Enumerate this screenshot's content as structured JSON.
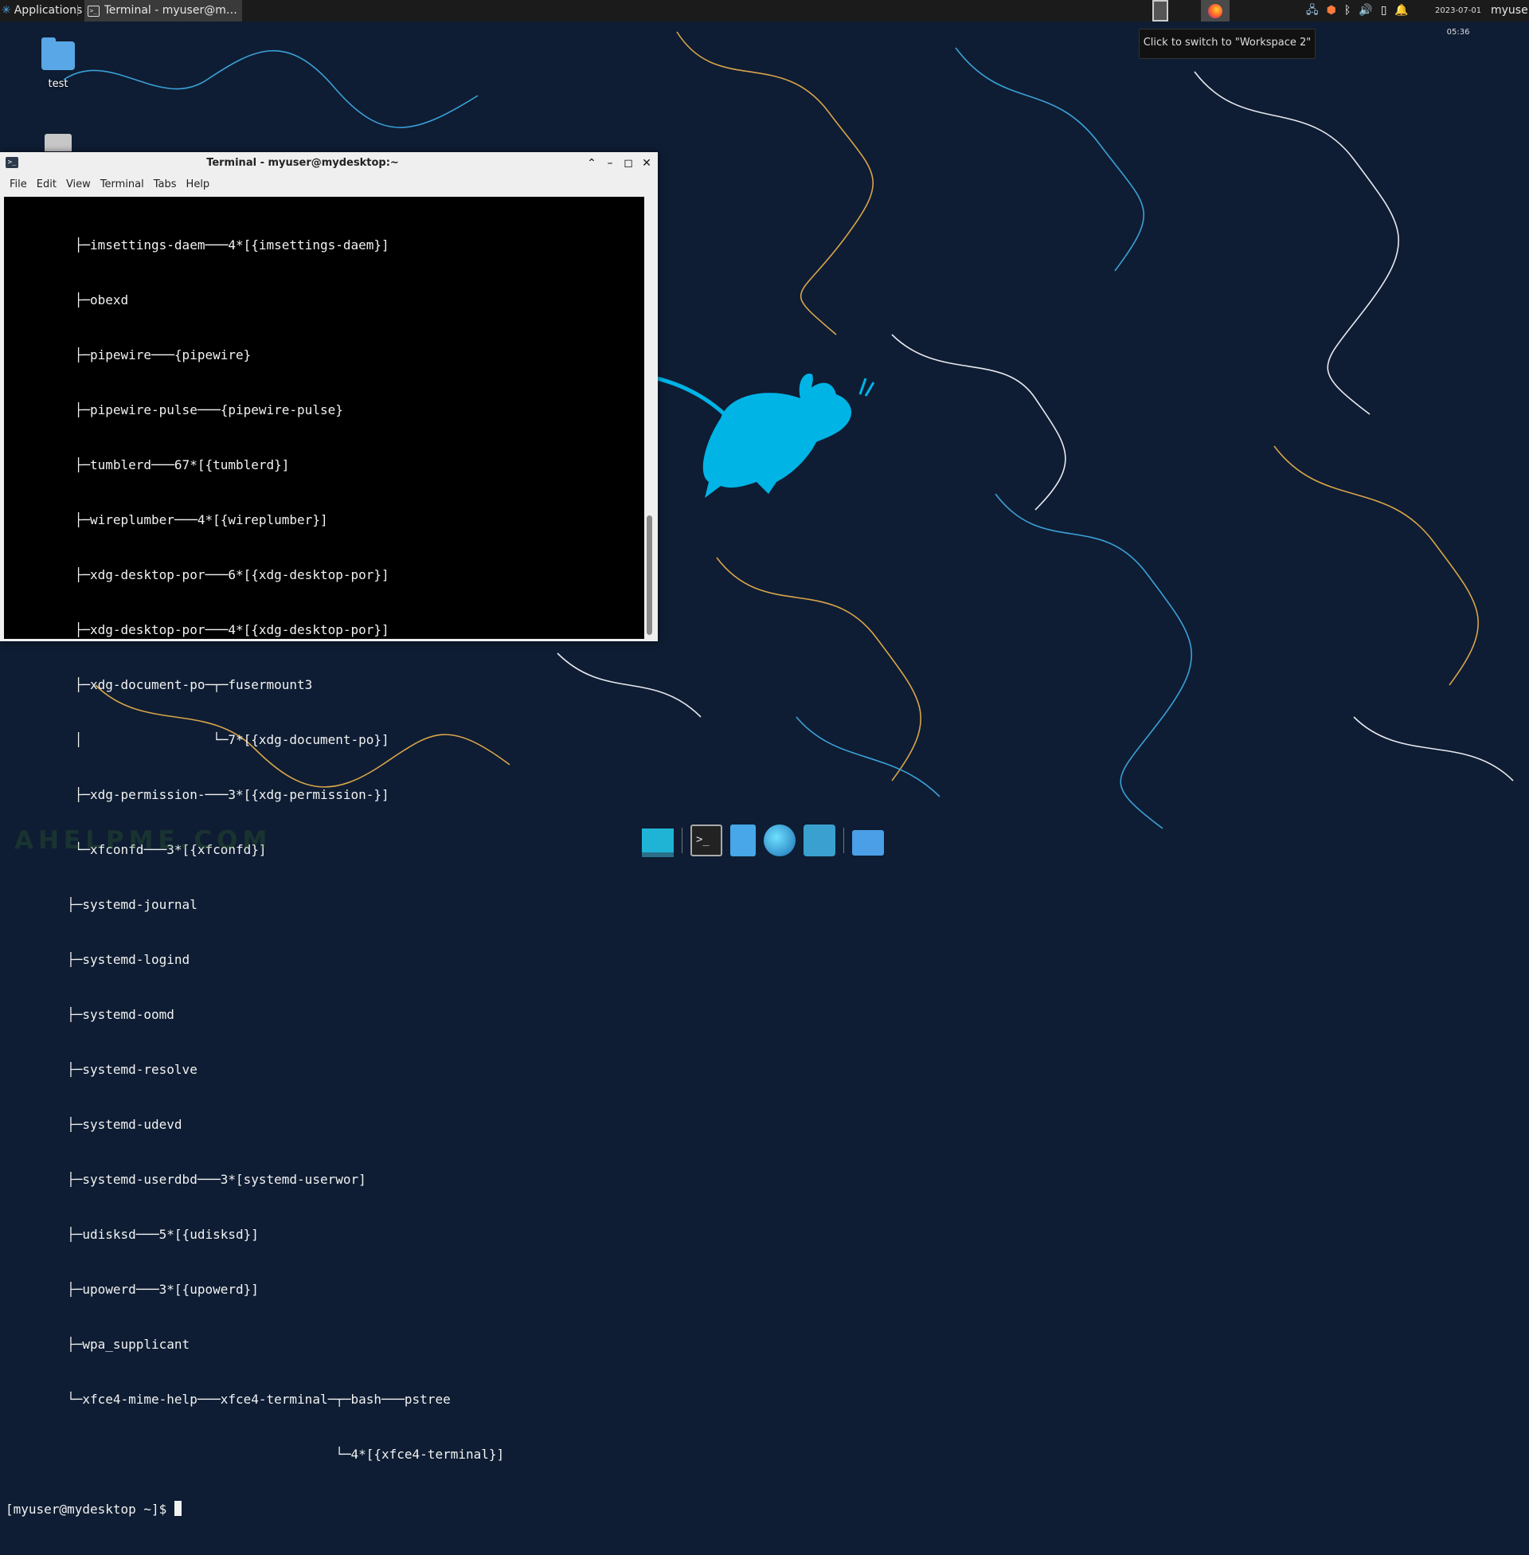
{
  "top_panel": {
    "applications_label": "Applications",
    "task_title": "Terminal - myuser@myde...",
    "clock_date": "2023-07-01",
    "clock_time": "05:36",
    "username": "myuser"
  },
  "tooltip": {
    "text": "Click to switch to \"Workspace 2\""
  },
  "desktop": {
    "folder_label": "test"
  },
  "terminal": {
    "window_title": "Terminal - myuser@mydesktop:~",
    "menu": [
      "File",
      "Edit",
      "View",
      "Terminal",
      "Tabs",
      "Help"
    ],
    "lines": [
      "         ├─imsettings-daem───4*[{imsettings-daem}]",
      "         ├─obexd",
      "         ├─pipewire───{pipewire}",
      "         ├─pipewire-pulse───{pipewire-pulse}",
      "         ├─tumblerd───67*[{tumblerd}]",
      "         ├─wireplumber───4*[{wireplumber}]",
      "         ├─xdg-desktop-por───6*[{xdg-desktop-por}]",
      "         ├─xdg-desktop-por───4*[{xdg-desktop-por}]",
      "         ├─xdg-document-po─┬─fusermount3",
      "         │                 └─7*[{xdg-document-po}]",
      "         ├─xdg-permission-───3*[{xdg-permission-}]",
      "         └─xfconfd───3*[{xfconfd}]",
      "        ├─systemd-journal",
      "        ├─systemd-logind",
      "        ├─systemd-oomd",
      "        ├─systemd-resolve",
      "        ├─systemd-udevd",
      "        ├─systemd-userdbd───3*[systemd-userwor]",
      "        ├─udisksd───5*[{udisksd}]",
      "        ├─upowerd───3*[{upowerd}]",
      "        ├─wpa_supplicant",
      "        └─xfce4-mime-help───xfce4-terminal─┬─bash───pstree",
      "                                           └─4*[{xfce4-terminal}]"
    ],
    "prompt": "[myuser@mydesktop ~]$ "
  },
  "watermark": "AHELPME.COM",
  "colors": {
    "wallpaper": "#0e1d33",
    "panel": "#1b1b1b",
    "terminal_bg": "#000000",
    "terminal_fg": "#f2f2f2",
    "xfce_mouse": "#00b4e6"
  },
  "icons": {
    "apps_menu": "xfce-logo-icon",
    "workspace_2": "firefox-icon",
    "tray": [
      "network-icon",
      "shield-icon",
      "bluetooth-icon",
      "volume-icon",
      "battery-icon",
      "bell-icon"
    ],
    "dock": [
      "show-desktop-icon",
      "terminal-icon",
      "file-manager-icon",
      "web-browser-icon",
      "app-finder-icon",
      "folder-icon"
    ]
  }
}
